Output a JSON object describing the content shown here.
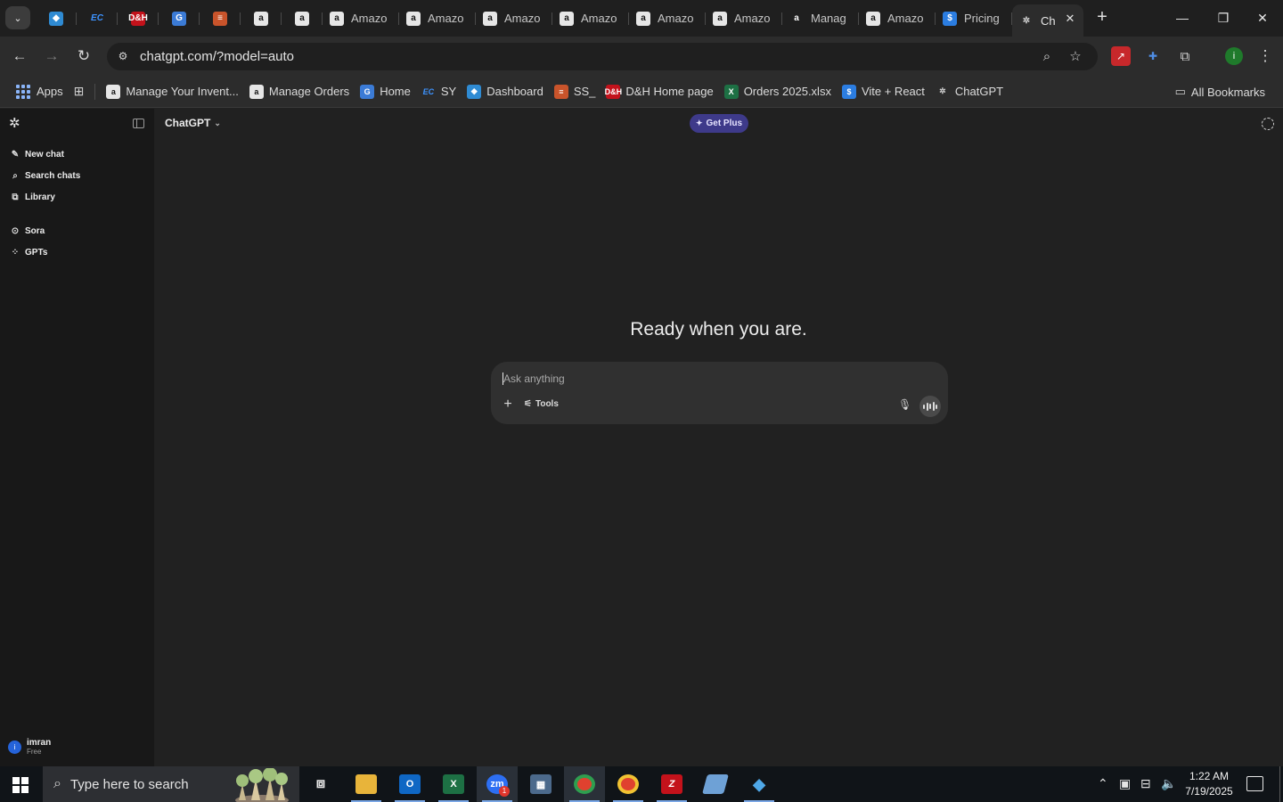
{
  "browser": {
    "tabs": [
      {
        "title": "",
        "icon": "diamond-icon"
      },
      {
        "title": "",
        "icon": "ec-icon"
      },
      {
        "title": "",
        "icon": "dh-icon"
      },
      {
        "title": "",
        "icon": "google-doc-icon"
      },
      {
        "title": "",
        "icon": "stack-icon"
      },
      {
        "title": "",
        "icon": "amazon-icon"
      },
      {
        "title": "",
        "icon": "amazon-icon"
      },
      {
        "title": "Amazo",
        "icon": "amazon-icon"
      },
      {
        "title": "Amazo",
        "icon": "amazon-icon"
      },
      {
        "title": "Amazo",
        "icon": "amazon-icon"
      },
      {
        "title": "Amazo",
        "icon": "amazon-icon"
      },
      {
        "title": "Amazo",
        "icon": "amazon-icon"
      },
      {
        "title": "Amazo",
        "icon": "amazon-icon"
      },
      {
        "title": "Manag",
        "icon": "amazon-icon"
      },
      {
        "title": "Amazo",
        "icon": "amazon-icon"
      },
      {
        "title": "Pricing",
        "icon": "dollar-icon"
      },
      {
        "title": "Ch",
        "icon": "chatgpt-icon",
        "active": true
      }
    ],
    "url": "chatgpt.com/?model=auto",
    "bookmarks": [
      {
        "label": "Apps",
        "icon": "apps-grid-icon"
      },
      {
        "label": "Manage Your Invent...",
        "icon": "amazon-icon"
      },
      {
        "label": "Manage Orders",
        "icon": "amazon-icon"
      },
      {
        "label": "Home",
        "icon": "google-doc-icon"
      },
      {
        "label": "SY",
        "icon": "ec-icon"
      },
      {
        "label": "Dashboard",
        "icon": "diamond-icon"
      },
      {
        "label": "SS_",
        "icon": "stack-icon"
      },
      {
        "label": "D&H Home page",
        "icon": "dh-icon"
      },
      {
        "label": "Orders 2025.xlsx",
        "icon": "excel-icon"
      },
      {
        "label": "Vite + React",
        "icon": "dollar-icon"
      },
      {
        "label": "ChatGPT",
        "icon": "chatgpt-icon"
      }
    ],
    "all_bookmarks": "All Bookmarks",
    "profile_initial": "i",
    "colors": {
      "accent": "#8ab4f8",
      "profile": "#1f7a2b"
    }
  },
  "sidebar": {
    "items": [
      {
        "label": "New chat",
        "icon": "compose-icon"
      },
      {
        "label": "Search chats",
        "icon": "search-icon"
      },
      {
        "label": "Library",
        "icon": "library-icon"
      },
      {
        "label": "Sora",
        "icon": "play-circle-icon"
      },
      {
        "label": "GPTs",
        "icon": "grid-icon"
      }
    ],
    "user": {
      "name": "imran",
      "plan": "Free",
      "initial": "i"
    }
  },
  "main": {
    "model_selector": "ChatGPT",
    "get_plus": "Get Plus",
    "hero": "Ready when you are.",
    "composer": {
      "placeholder": "Ask anything",
      "tools_label": "Tools"
    },
    "colors": {
      "get_plus_bg": "#3e3a8a",
      "composer_bg": "#303030"
    }
  },
  "taskbar": {
    "search_placeholder": "Type here to search",
    "apps": [
      {
        "name": "task-view-icon"
      },
      {
        "name": "file-explorer-icon"
      },
      {
        "name": "outlook-icon"
      },
      {
        "name": "excel-icon"
      },
      {
        "name": "zoom-icon",
        "badge": "1"
      },
      {
        "name": "calculator-icon"
      },
      {
        "name": "chrome-icon"
      },
      {
        "name": "chrome-profile-icon"
      },
      {
        "name": "filezilla-icon"
      },
      {
        "name": "notes-icon"
      },
      {
        "name": "diamond-app-icon"
      }
    ],
    "time": "1:22 AM",
    "date": "7/19/2025"
  }
}
